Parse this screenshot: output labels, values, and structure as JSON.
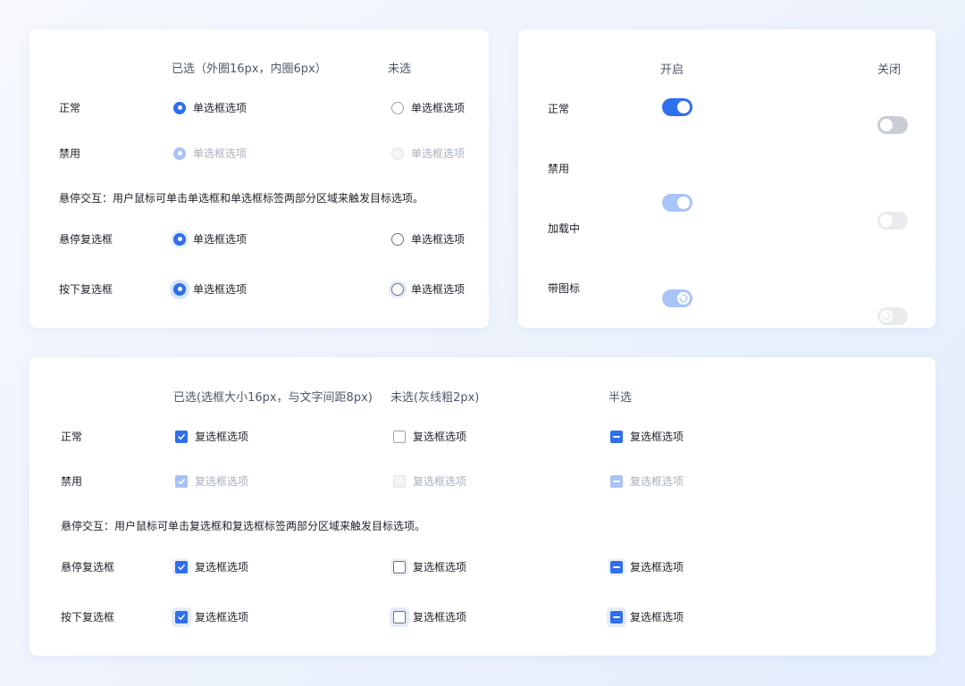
{
  "radio_panel": {
    "headers": {
      "selected": "已选（外圈16px，内圈6px）",
      "unselected": "未选"
    },
    "rows": {
      "normal": "正常",
      "disabled": "禁用",
      "hover": "悬停复选框",
      "pressed": "按下复选框"
    },
    "note": "悬停交互：用户鼠标可单击单选框和单选框标签两部分区域来触发目标选项。",
    "option_label": "单选框选项"
  },
  "switch_panel": {
    "headers": {
      "on": "开启",
      "off": "关闭"
    },
    "rows": {
      "normal": "正常",
      "disabled": "禁用",
      "loading": "加载中",
      "with_icon": "带图标"
    },
    "icons": {
      "on": "check-icon",
      "off": "close-icon"
    }
  },
  "checkbox_panel": {
    "headers": {
      "selected": "已选(选框大小16px，与文字间距8px)",
      "unselected": "未选(灰线粗2px)",
      "indeterminate": "半选"
    },
    "rows": {
      "normal": "正常",
      "disabled": "禁用",
      "hover": "悬停复选框",
      "pressed": "按下复选框"
    },
    "note": "悬停交互：用户鼠标可单击复选框和复选框标签两部分区域来触发目标选项。",
    "option_label": "复选框选项"
  },
  "colors": {
    "accent": "#2f6fed",
    "accent_disabled": "#a6c2f6",
    "border": "#9aa2af",
    "switch_off": "#c9cdd4"
  }
}
